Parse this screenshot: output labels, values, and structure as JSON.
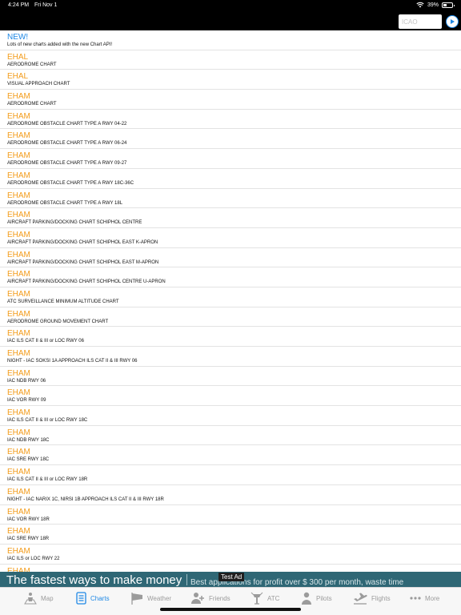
{
  "status_bar": {
    "time": "4:24 PM",
    "date": "Fri Nov 1",
    "battery_text": "39%",
    "battery_level": 0.39
  },
  "search": {
    "placeholder": "ICAO",
    "value": ""
  },
  "news": {
    "title": "NEW!",
    "subtitle": "Lots of new charts added with the new Chart API!"
  },
  "charts": [
    {
      "icao": "EHAL",
      "name": "AERODROME CHART"
    },
    {
      "icao": "EHAL",
      "name": "VISUAL APPROACH CHART"
    },
    {
      "icao": "EHAM",
      "name": "AERODROME CHART"
    },
    {
      "icao": "EHAM",
      "name": "AERODROME OBSTACLE CHART TYPE A RWY 04-22"
    },
    {
      "icao": "EHAM",
      "name": "AERODROME OBSTACLE CHART TYPE A RWY 06-24"
    },
    {
      "icao": "EHAM",
      "name": "AERODROME OBSTACLE CHART TYPE A RWY 09-27"
    },
    {
      "icao": "EHAM",
      "name": "AERODROME OBSTACLE CHART TYPE A RWY 18C-36C"
    },
    {
      "icao": "EHAM",
      "name": "AERODROME OBSTACLE CHART TYPE A RWY 18L"
    },
    {
      "icao": "EHAM",
      "name": "AIRCRAFT PARKING/DOCKING CHART SCHIPHOL CENTRE"
    },
    {
      "icao": "EHAM",
      "name": "AIRCRAFT PARKING/DOCKING CHART SCHIPHOL EAST K-APRON"
    },
    {
      "icao": "EHAM",
      "name": "AIRCRAFT PARKING/DOCKING CHART SCHIPHOL EAST M-APRON"
    },
    {
      "icao": "EHAM",
      "name": "AIRCRAFT PARKING/DOCKING CHART SCHIPHOL CENTRE U-APRON"
    },
    {
      "icao": "EHAM",
      "name": "ATC SURVEILLANCE MINIMUM ALTITUDE CHART"
    },
    {
      "icao": "EHAM",
      "name": "AERODROME GROUND MOVEMENT CHART"
    },
    {
      "icao": "EHAM",
      "name": "IAC ILS CAT II & III or LOC RWY 06"
    },
    {
      "icao": "EHAM",
      "name": "NIGHT - IAC SOKSI 1A APPROACH ILS CAT II & III RWY 06"
    },
    {
      "icao": "EHAM",
      "name": "IAC NDB RWY 06"
    },
    {
      "icao": "EHAM",
      "name": "IAC VOR RWY 09"
    },
    {
      "icao": "EHAM",
      "name": "IAC ILS CAT II & III or LOC RWY 18C"
    },
    {
      "icao": "EHAM",
      "name": "IAC NDB RWY 18C"
    },
    {
      "icao": "EHAM",
      "name": "IAC SRE RWY 18C"
    },
    {
      "icao": "EHAM",
      "name": "IAC ILS CAT II & III or LOC RWY 18R"
    },
    {
      "icao": "EHAM",
      "name": "NIGHT - IAC NARIX 1C, NIRSI 1B APPROACH ILS CAT II & III RWY 18R"
    },
    {
      "icao": "EHAM",
      "name": "IAC VOR RWY 18R"
    },
    {
      "icao": "EHAM",
      "name": "IAC SRE RWY 18R"
    },
    {
      "icao": "EHAM",
      "name": "IAC ILS or LOC RWY 22"
    },
    {
      "icao": "EHAM",
      "name": ""
    }
  ],
  "ad": {
    "label": "Test Ad",
    "headline": "The fastest ways to make money",
    "body": "Best applications for profit over $ 300 per month, waste time"
  },
  "tabs": [
    {
      "key": "map",
      "label": "Map",
      "icon": "map-person-icon",
      "active": false
    },
    {
      "key": "charts",
      "label": "Charts",
      "icon": "document-list-icon",
      "active": true
    },
    {
      "key": "weather",
      "label": "Weather",
      "icon": "windsock-icon",
      "active": false
    },
    {
      "key": "friends",
      "label": "Friends",
      "icon": "add-person-icon",
      "active": false
    },
    {
      "key": "atc",
      "label": "ATC",
      "icon": "atc-tower-icon",
      "active": false
    },
    {
      "key": "pilots",
      "label": "Pilots",
      "icon": "pilot-person-icon",
      "active": false
    },
    {
      "key": "flights",
      "label": "Flights",
      "icon": "plane-departure-icon",
      "active": false
    },
    {
      "key": "more",
      "label": "More",
      "icon": "ellipsis-icon",
      "active": false
    }
  ],
  "colors": {
    "accent": "#1e88e5",
    "icao_text": "#f39c1b",
    "ad_background": "#2f6775"
  }
}
